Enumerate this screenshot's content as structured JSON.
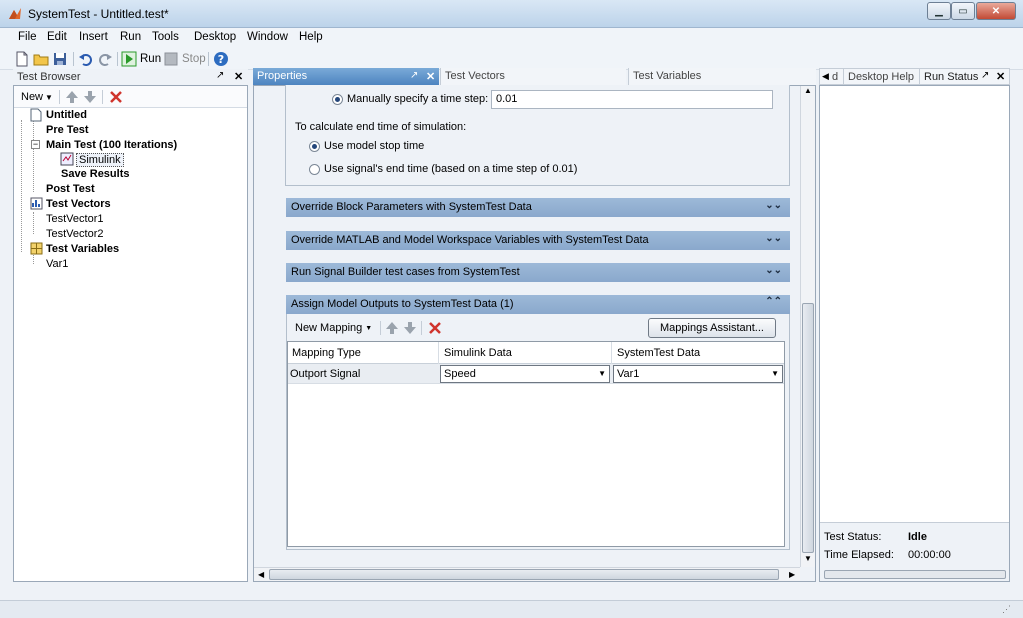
{
  "window": {
    "title": "SystemTest - Untitled.test*",
    "min_glyph": "▁",
    "max_glyph": "▭",
    "close_glyph": "✕"
  },
  "menu": [
    "File",
    "Edit",
    "Insert",
    "Run",
    "Tools",
    "Desktop",
    "Window",
    "Help"
  ],
  "toolbar": {
    "run_label": "Run",
    "stop_label": "Stop"
  },
  "test_browser": {
    "title": "Test Browser",
    "new_label": "New",
    "tree": [
      {
        "label": "Untitled",
        "bold": true
      },
      {
        "label": "Pre Test",
        "bold": true
      },
      {
        "label": "Main Test (100 Iterations)",
        "bold": true
      },
      {
        "label": "Simulink",
        "bold": false
      },
      {
        "label": "Save Results",
        "bold": true
      },
      {
        "label": "Post Test",
        "bold": true
      },
      {
        "label": "Test Vectors",
        "bold": true
      },
      {
        "label": "TestVector1",
        "bold": false
      },
      {
        "label": "TestVector2",
        "bold": false
      },
      {
        "label": "Test Variables",
        "bold": true
      },
      {
        "label": "Var1",
        "bold": false
      }
    ]
  },
  "tabs": {
    "properties": "Properties",
    "test_vectors": "Test Vectors",
    "test_variables": "Test Variables"
  },
  "properties": {
    "manual_step_label": "Manually specify a time step:",
    "manual_step_value": "0.01",
    "end_time_heading": "To calculate end time of simulation:",
    "use_model_stop": "Use model stop time",
    "use_signal_end": "Use signal's end time (based on a time step of 0.01)",
    "sections": [
      "Override Block Parameters with SystemTest Data",
      "Override MATLAB and Model Workspace Variables with SystemTest Data",
      "Run Signal Builder test cases from SystemTest",
      "Assign Model Outputs to SystemTest Data (1)"
    ],
    "new_mapping_label": "New Mapping",
    "mappings_assistant_label": "Mappings Assistant...",
    "table": {
      "headers": [
        "Mapping Type",
        "Simulink Data",
        "SystemTest Data"
      ],
      "rows": [
        [
          "Outport Signal",
          "Speed",
          "Var1"
        ]
      ]
    }
  },
  "right_panel": {
    "tab_d": "d",
    "tab_desktop_help": "Desktop Help",
    "tab_run_status": "Run Status",
    "status_label": "Test Status:",
    "status_value": "Idle",
    "elapsed_label": "Time Elapsed:",
    "elapsed_value": "00:00:00"
  },
  "colors": {
    "accent": "#4d84c0",
    "section": "#8aa8cc",
    "delete_red": "#d0342c",
    "run_green": "#2a9a2a"
  }
}
